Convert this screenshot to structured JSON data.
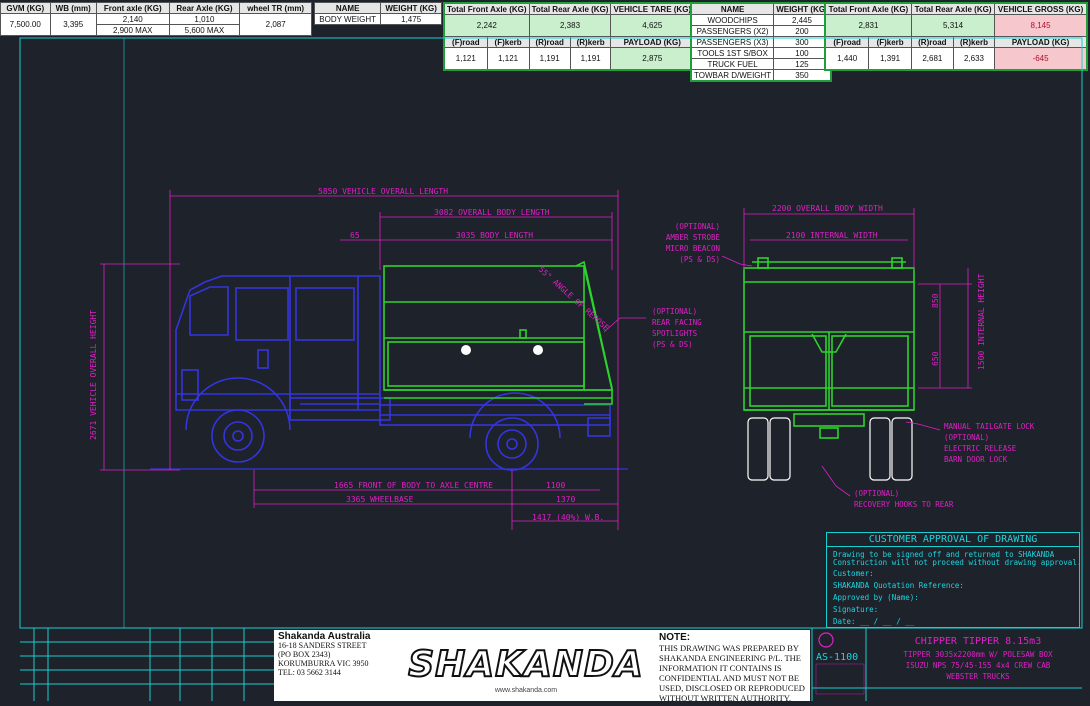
{
  "t1": {
    "headers": [
      "GVM (KG)",
      "WB (mm)",
      "Front axle (KG)",
      "Rear Axle (KG)",
      "wheel TR (mm)"
    ],
    "gvm": "7,500.00",
    "wb": "3,395",
    "front_axle": "2,140",
    "front_axle_max": "2,900 MAX",
    "rear_axle": "1,010",
    "rear_axle_max": "5,600 MAX",
    "wheel_tr": "2,087"
  },
  "t2": {
    "headers": [
      "NAME",
      "WEIGHT (KG)"
    ],
    "name": "BODY WEIGHT",
    "weight": "1,475"
  },
  "t3": {
    "headers": [
      "Total Front Axle (KG)",
      "Total Rear Axle (KG)",
      "VEHICLE TARE (KG)"
    ],
    "total_front": "2,242",
    "total_rear": "2,383",
    "tare": "4,625",
    "sub_headers": [
      "(F)road",
      "(F)kerb",
      "(R)road",
      "(R)kerb"
    ],
    "sub_values": [
      "1,121",
      "1,121",
      "1,191",
      "1,191"
    ],
    "payload_label": "PAYLOAD (KG)",
    "payload": "2,875"
  },
  "t4": {
    "headers": [
      "NAME",
      "WEIGHT (KG)"
    ],
    "rows": [
      {
        "name": "WOODCHIPS",
        "weight": "2,445"
      },
      {
        "name": "PASSENGERS (X2)",
        "weight": "200"
      },
      {
        "name": "PASSENGERS (X3)",
        "weight": "300"
      },
      {
        "name": "TOOLS 1ST S/BOX",
        "weight": "100"
      },
      {
        "name": "TRUCK FUEL",
        "weight": "125"
      },
      {
        "name": "TOWBAR D/WEIGHT",
        "weight": "350"
      }
    ]
  },
  "t5": {
    "headers": [
      "Total Front Axle (KG)",
      "Total Rear Axle (KG)",
      "VEHICLE GROSS (KG)"
    ],
    "total_front": "2,831",
    "total_rear": "5,314",
    "gross": "8,145",
    "sub_headers": [
      "(F)road",
      "(F)kerb",
      "(R)road",
      "(R)kerb"
    ],
    "sub_values": [
      "1,440",
      "1,391",
      "2,681",
      "2,633"
    ],
    "payload_label": "PAYLOAD (KG)",
    "payload": "-645"
  },
  "dims": {
    "overall_length": "5850 VEHICLE OVERALL LENGTH",
    "overall_body_length": "3082 OVERALL BODY LENGTH",
    "body_length": "3035 BODY LENGTH",
    "offset": "65",
    "overall_height": "2671 VEHICLE OVERALL HEIGHT",
    "front_to_axle": "1665 FRONT OF BODY TO AXLE CENTRE",
    "d1100": "1100",
    "wheelbase": "3365 WHEELBASE",
    "d1370": "1370",
    "rear_overhang": "1417 (40%) W.B.",
    "overall_width": "2200 OVERALL BODY WIDTH",
    "internal_width": "2100 INTERNAL WIDTH",
    "d850": "850",
    "d650": "650",
    "internal_height": "1500 INTERNAL HEIGHT",
    "angle": "55° ANGLE OF REPOSE"
  },
  "notes": {
    "amber": [
      "(OPTIONAL)",
      "AMBER STROBE",
      "MICRO BEACON",
      "(PS & DS)"
    ],
    "spot": [
      "(OPTIONAL)",
      "REAR FACING",
      "SPOTLIGHTS",
      "(PS & DS)"
    ],
    "tailgate": [
      "MANUAL TAILGATE LOCK",
      "(OPTIONAL)",
      "ELECTRIC RELEASE",
      "BARN DOOR LOCK"
    ],
    "recovery": [
      "(OPTIONAL)",
      "RECOVERY HOOKS TO REAR"
    ]
  },
  "approval": {
    "title": "CUSTOMER APPROVAL OF DRAWING",
    "line1": "Drawing to be signed off and returned to SHAKANDA",
    "line2": "Construction will not proceed without drawing approval.",
    "customer": "Customer:",
    "quote": "SHAKANDA Quotation Reference:",
    "approved": "Approved by (Name):",
    "signature": "Signature:",
    "date": "Date: __ / __ / __"
  },
  "company": {
    "name": "Shakanda Australia",
    "street": "16-18 SANDERS STREET",
    "pobox": "(PO BOX 2343)",
    "city": "KORUMBURRA VIC 3950",
    "tel": "TEL: 03 5662 3144",
    "logo": "SHAKANDA",
    "web": "www.shakanda.com"
  },
  "note": {
    "title": "NOTE:",
    "text": "THIS DRAWING WAS PREPARED BY SHAKANDA ENGINEERING P/L. THE INFORMATION IT CONTAINS IS CONFIDENTIAL AND MUST NOT BE USED, DISCLOSED OR REPRODUCED WITHOUT WRITTEN AUTHORITY."
  },
  "drawing_id": {
    "code": "AS-1100",
    "title": "CHIPPER TIPPER 8.15m3",
    "line2": "TIPPER 3035x2200mm W/ POLESAW BOX",
    "line3": "ISUZU NPS 75/45-155 4x4 CREW CAB",
    "line4": "WEBSTER TRUCKS"
  },
  "colors": {
    "background": "#1e222a",
    "cab": "#3434e0",
    "body": "#2ed22e",
    "dimension": "#e020c8",
    "frame": "#18d0d0",
    "green_cell": "#c9efcc",
    "red_cell": "#f6c7cc"
  }
}
